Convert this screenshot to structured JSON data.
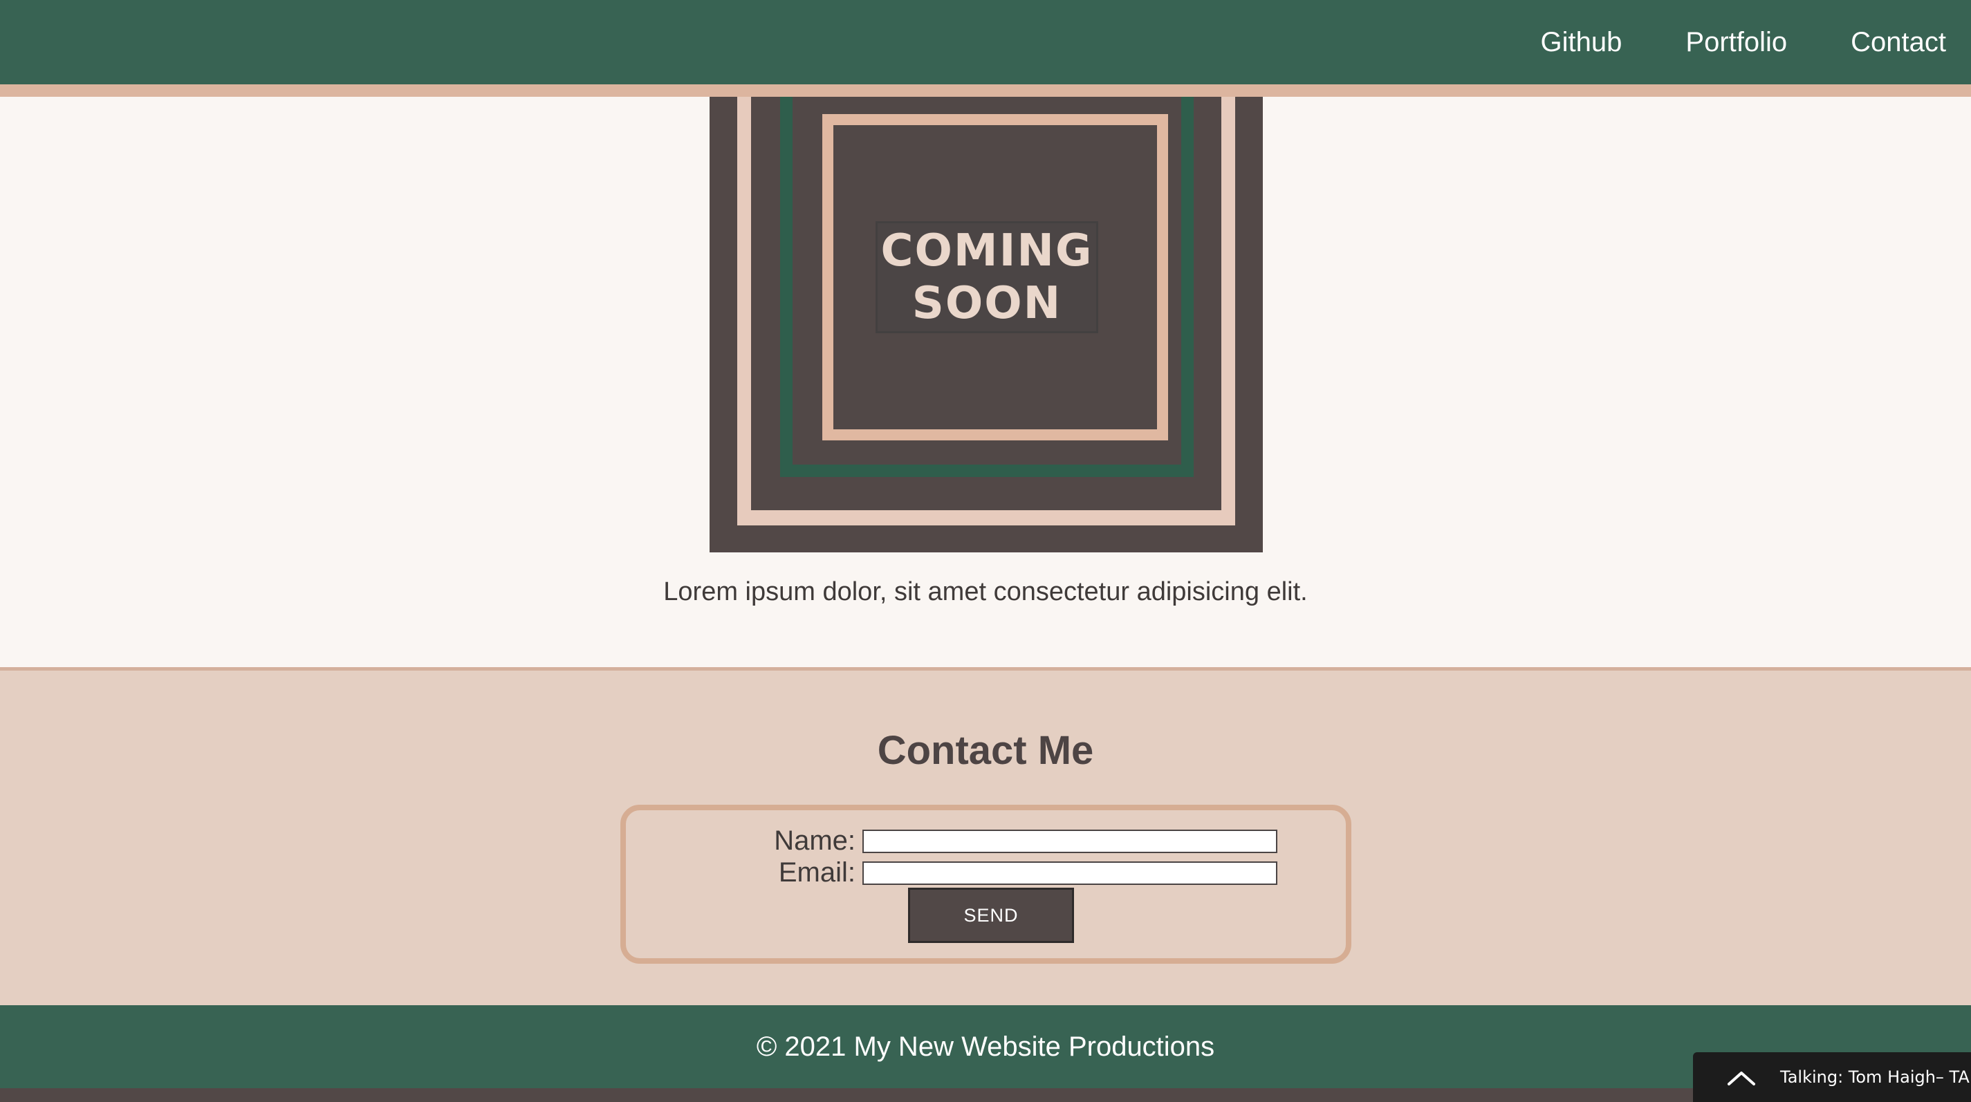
{
  "nav": {
    "items": [
      "Github",
      "Portfolio",
      "Contact"
    ]
  },
  "hero": {
    "image_line1": "COMING",
    "image_line2": "SOON",
    "text": "Lorem ipsum dolor, sit amet consectetur adipisicing elit."
  },
  "contact": {
    "title": "Contact Me",
    "name_label": "Name:",
    "email_label": "Email:",
    "name_value": "",
    "email_value": "",
    "send_label": "SEND"
  },
  "footer": {
    "text": "© 2021 My New Website Productions"
  },
  "player": {
    "text": "Talking: Tom Haigh– TA",
    "icon": "chevron-up-icon"
  },
  "colors": {
    "header": "#386353",
    "accent": "#dcb59f",
    "contact_bg": "#e4cfc2",
    "dark": "#524847"
  }
}
